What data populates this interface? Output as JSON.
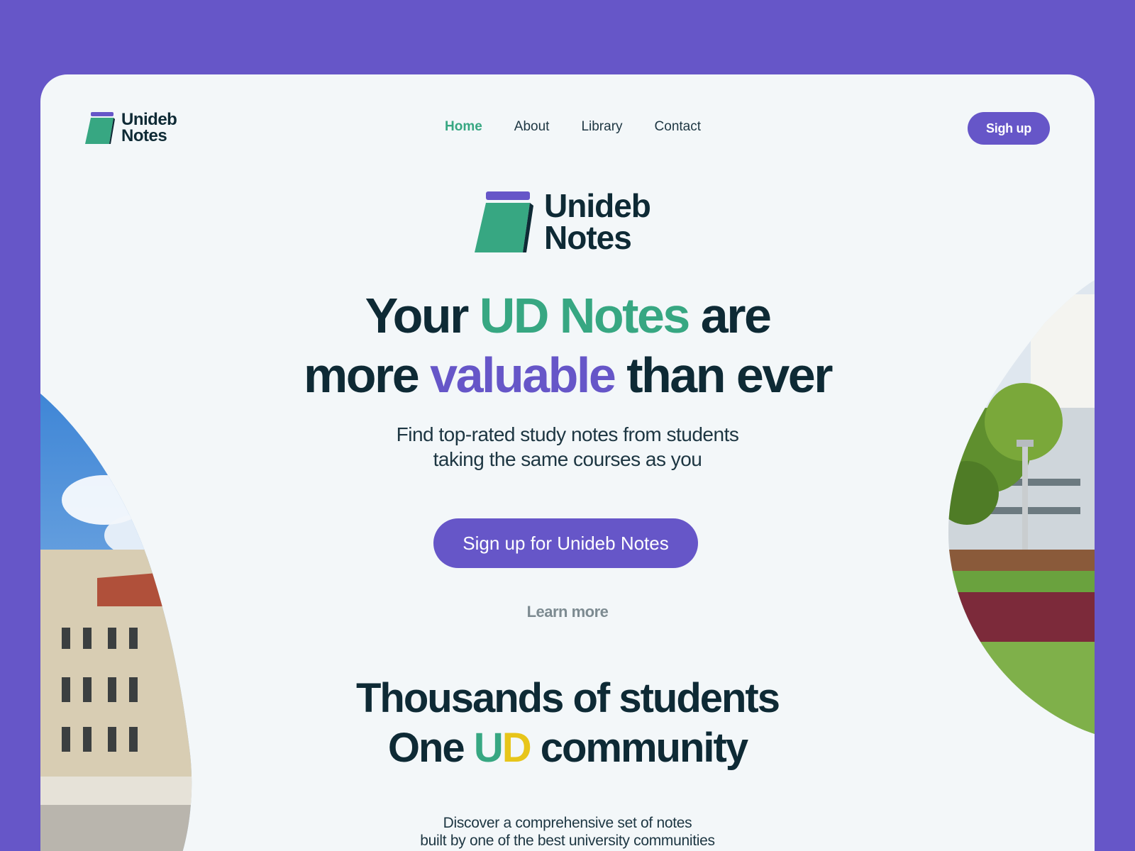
{
  "brand": {
    "line1": "Unideb",
    "line2": "Notes",
    "colors": {
      "purple": "#6656c8",
      "green": "#37a782",
      "yellow": "#e7c51a",
      "dark": "#0e2a35"
    }
  },
  "nav": {
    "items": [
      {
        "label": "Home",
        "active": true
      },
      {
        "label": "About"
      },
      {
        "label": "Library"
      },
      {
        "label": "Contact"
      }
    ],
    "signup_label": "Sigh up"
  },
  "hero": {
    "headline": {
      "part1": "Your ",
      "highlight1": "UD Notes",
      "part2": " are",
      "part3": "more ",
      "highlight2": "valuable",
      "part4": " than ever"
    },
    "subtitle_line1": "Find top-rated study notes from students",
    "subtitle_line2": "taking the same courses as you",
    "cta_label": "Sign up for Unideb Notes",
    "learn_more": "Learn more"
  },
  "community": {
    "line1": "Thousands of students",
    "line2_prefix": "One ",
    "ud_u": "U",
    "ud_d": "D",
    "line2_suffix": " community",
    "desc_line1": "Discover a comprehensive set of notes",
    "desc_line2": "built by one of the best university communities"
  }
}
